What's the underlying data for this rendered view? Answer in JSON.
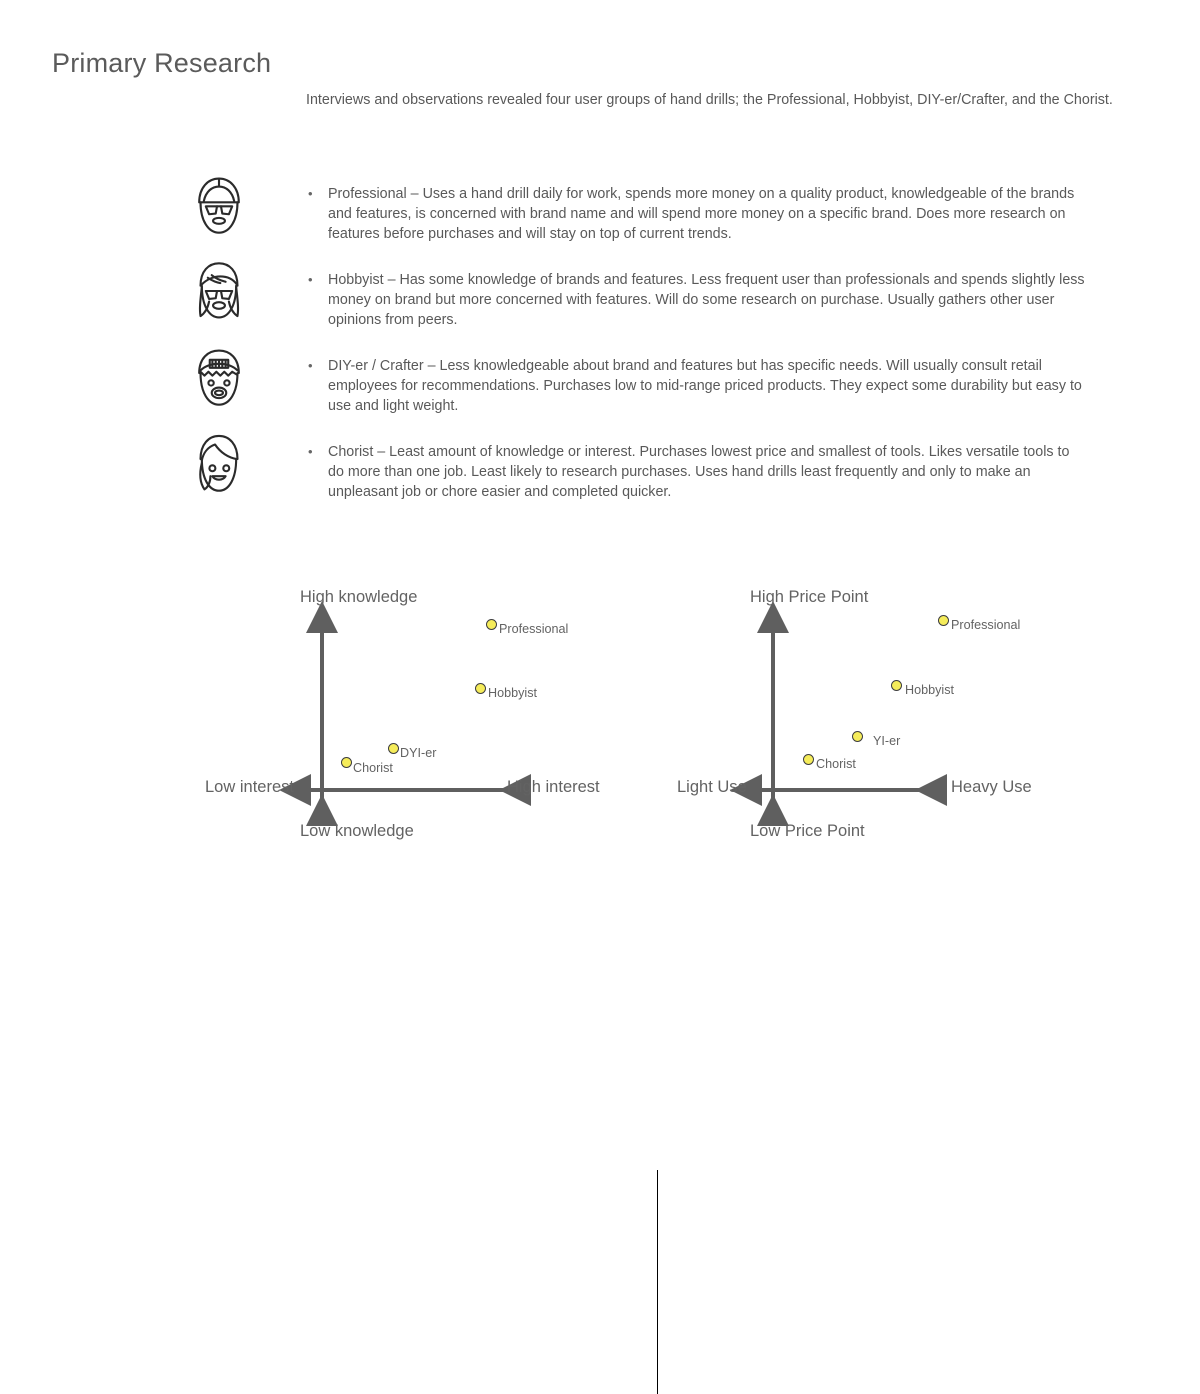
{
  "page": {
    "title": "Primary Research",
    "intro": "Interviews and observations revealed four user groups of hand drills; the Professional, Hobbyist, DIY-er/Crafter, and the Chorist.",
    "text_color": "#595959",
    "title_color": "#5b5b5b"
  },
  "personas": [
    {
      "id": "professional",
      "icon": "hardhat-bearded-worker-avatar-icon",
      "bullet": "•",
      "text": "Professional – Uses a hand drill daily for work, spends more money on a quality product, knowledgeable of the brands and features, is concerned with brand name and will spend more money on a specific brand. Does more research on features before purchases and will stay on top of current trends."
    },
    {
      "id": "hobbyist",
      "icon": "long-hair-goggles-avatar-icon",
      "bullet": "•",
      "text": "Hobbyist – Has some knowledge of brands and features. Less frequent user than professionals and spends slightly less money on brand but more concerned with features. Will do some research on purchase. Usually gathers other user opinions from peers."
    },
    {
      "id": "diyer-crafter",
      "icon": "backwards-cap-avatar-icon",
      "bullet": "•",
      "text": "DIY-er / Crafter – Less knowledgeable about brand and features but has specific needs. Will usually consult retail employees for recommendations. Purchases low to mid-range priced products. They expect some durability but easy to use and light weight."
    },
    {
      "id": "chorist",
      "icon": "short-hair-smiling-avatar-icon",
      "bullet": "•",
      "text": "Chorist – Least amount of knowledge or interest. Purchases lowest price and smallest of tools. Likes versatile tools to do more than one job. Least likely to research purchases. Uses hand drills least frequently and only to make an unpleasant job or chore easier and completed quicker."
    }
  ],
  "chart_data": [
    {
      "id": "knowledge-vs-interest",
      "type": "scatter",
      "title": "",
      "xlabel_left": "Low interest",
      "xlabel_right": "High interest",
      "ylabel_top": "High knowledge",
      "ylabel_bottom": "Low knowledge",
      "xlim": [
        -1,
        1
      ],
      "ylim": [
        -1,
        1
      ],
      "grid": false,
      "marker_fill": "#f5ec5a",
      "marker_stroke": "#3d3d3d",
      "points": [
        {
          "label": "Professional",
          "x": 0.42,
          "y": 0.76
        },
        {
          "label": "Hobbyist",
          "x": 0.34,
          "y": 0.43
        },
        {
          "label": "DYI-er",
          "x": 0.16,
          "y": 0.1
        },
        {
          "label": "Chorist",
          "x": 0.03,
          "y": 0.03
        }
      ]
    },
    {
      "id": "price-point-vs-use",
      "type": "scatter",
      "title": "",
      "xlabel_left": "Light Use",
      "xlabel_right": "Heavy Use",
      "ylabel_top": "High Price Point",
      "ylabel_bottom": "Low Price Point",
      "xlim": [
        -1,
        1
      ],
      "ylim": [
        -1,
        1
      ],
      "grid": false,
      "marker_fill": "#f5ec5a",
      "marker_stroke": "#3d3d3d",
      "points": [
        {
          "label": "Professional",
          "x": 0.48,
          "y": 0.79
        },
        {
          "label": "Hobbyist",
          "x": 0.35,
          "y": 0.43
        },
        {
          "label": "YI-er",
          "x": 0.24,
          "y": 0.21
        },
        {
          "label": "Chorist",
          "x": 0.08,
          "y": 0.05
        }
      ]
    }
  ]
}
